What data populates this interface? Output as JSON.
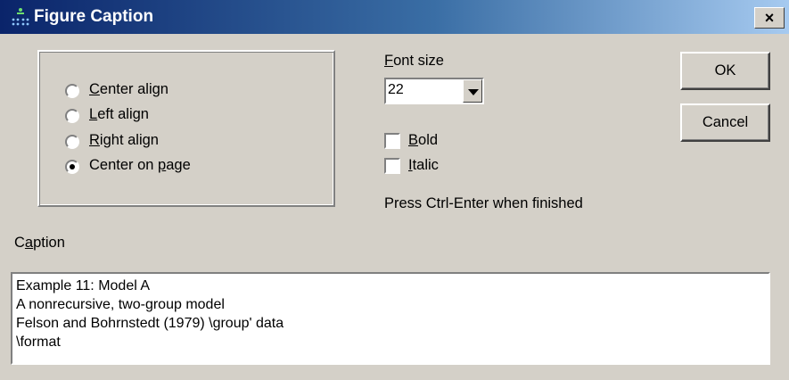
{
  "window": {
    "title": "Figure Caption",
    "close_glyph": "×",
    "title_icon": "figure-dots-icon"
  },
  "alignment": {
    "options": [
      {
        "pre": "",
        "key": "C",
        "post": "enter align",
        "selected": false
      },
      {
        "pre": "",
        "key": "L",
        "post": "eft align",
        "selected": false
      },
      {
        "pre": "",
        "key": "R",
        "post": "ight align",
        "selected": false
      },
      {
        "pre": "Center on ",
        "key": "p",
        "post": "age",
        "selected": true
      }
    ]
  },
  "font_size": {
    "label_key": "F",
    "label_rest": "ont size",
    "value": "22"
  },
  "style": {
    "bold": {
      "key": "B",
      "rest": "old",
      "checked": false
    },
    "italic": {
      "key": "I",
      "rest": "talic",
      "checked": false
    }
  },
  "hint": "Press Ctrl-Enter when finished",
  "buttons": {
    "ok": "OK",
    "cancel": "Cancel"
  },
  "caption": {
    "label_pre": "C",
    "label_key": "a",
    "label_post": "ption",
    "text": "Example 11: Model A\nA nonrecursive, two-group model\nFelson and Bohrnstedt (1979) \\group' data\n\\format"
  }
}
